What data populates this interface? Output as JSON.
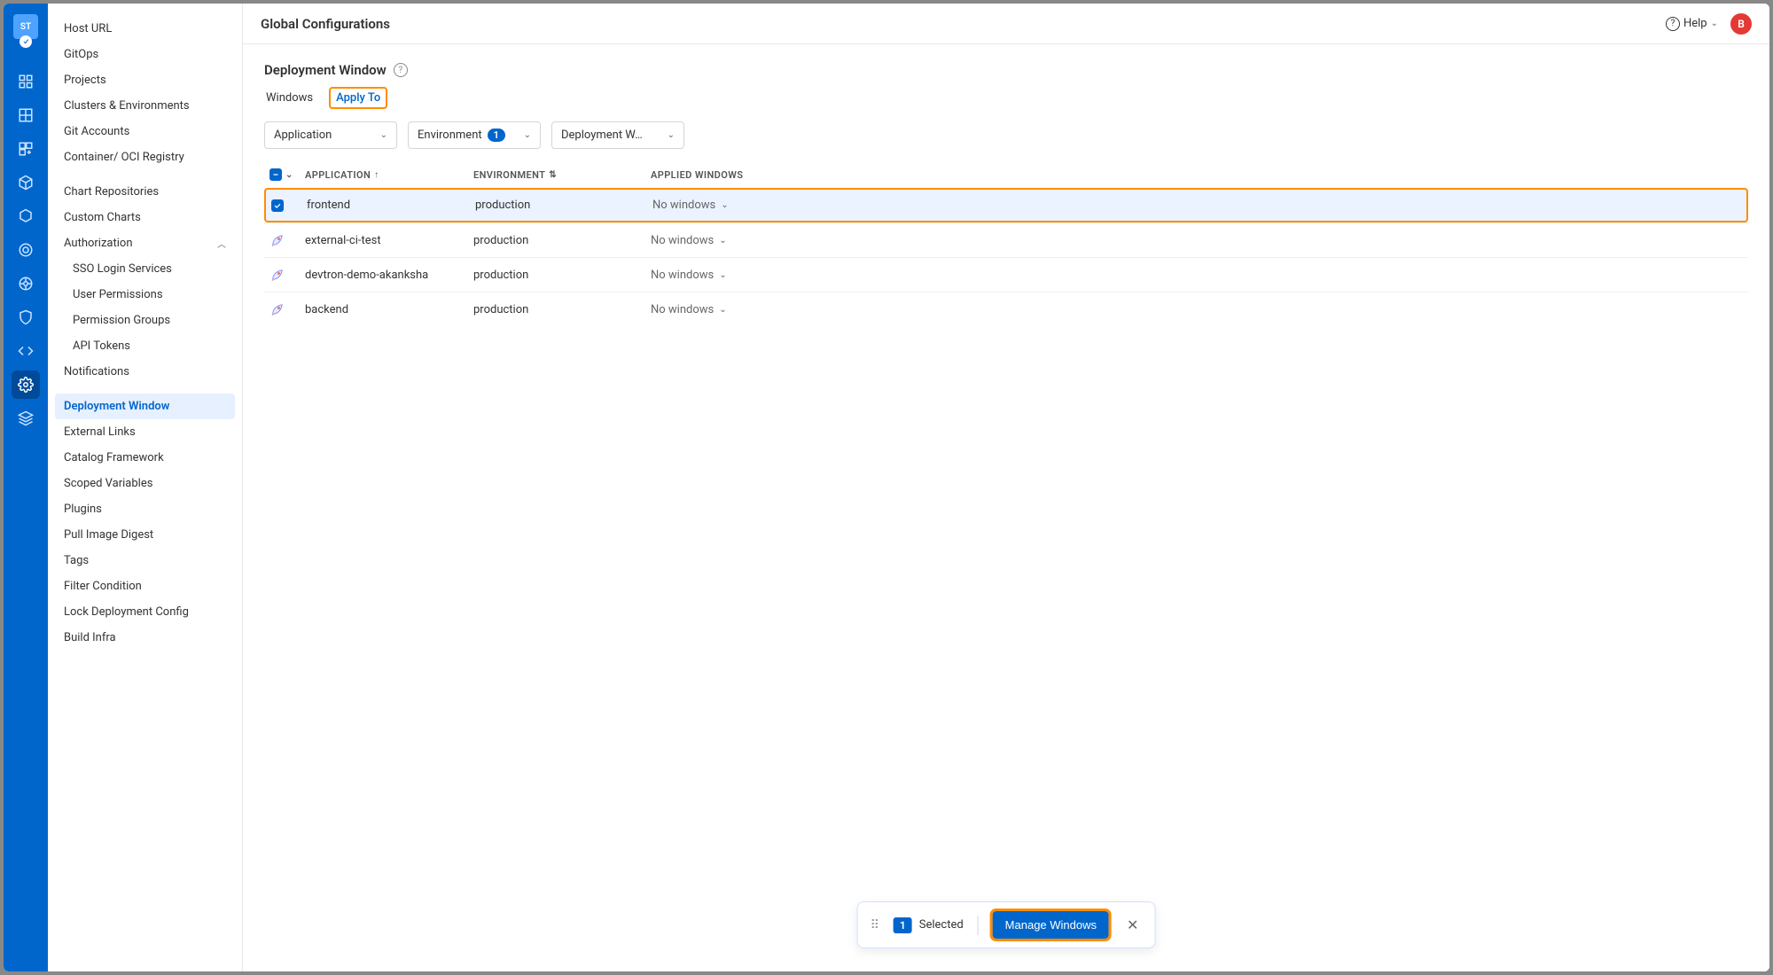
{
  "brand": {
    "logo_text": "ST",
    "avatar_initial": "B"
  },
  "topbar": {
    "title": "Global Configurations",
    "help_label": "Help"
  },
  "sidebar": {
    "items": [
      {
        "label": "Host URL"
      },
      {
        "label": "GitOps"
      },
      {
        "label": "Projects"
      },
      {
        "label": "Clusters & Environments"
      },
      {
        "label": "Git Accounts"
      },
      {
        "label": "Container/ OCI Registry"
      }
    ],
    "group2": [
      {
        "label": "Chart Repositories"
      },
      {
        "label": "Custom Charts"
      }
    ],
    "auth_label": "Authorization",
    "auth_items": [
      {
        "label": "SSO Login Services"
      },
      {
        "label": "User Permissions"
      },
      {
        "label": "Permission Groups"
      },
      {
        "label": "API Tokens"
      }
    ],
    "group3": [
      {
        "label": "Notifications"
      }
    ],
    "selected": {
      "label": "Deployment Window"
    },
    "group4": [
      {
        "label": "External Links"
      },
      {
        "label": "Catalog Framework"
      },
      {
        "label": "Scoped Variables"
      },
      {
        "label": "Plugins"
      },
      {
        "label": "Pull Image Digest"
      },
      {
        "label": "Tags"
      },
      {
        "label": "Filter Condition"
      },
      {
        "label": "Lock Deployment Config"
      },
      {
        "label": "Build Infra"
      }
    ]
  },
  "page": {
    "title": "Deployment Window",
    "tabs": {
      "windows": "Windows",
      "apply_to": "Apply To"
    },
    "filters": {
      "application": "Application",
      "environment": "Environment",
      "env_count": "1",
      "deployment_window": "Deployment W…"
    },
    "columns": {
      "app": "APPLICATION",
      "env": "ENVIRONMENT",
      "win": "APPLIED WINDOWS"
    },
    "rows": [
      {
        "app": "frontend",
        "env": "production",
        "win": "No windows",
        "checked": true
      },
      {
        "app": "external-ci-test",
        "env": "production",
        "win": "No windows",
        "checked": false
      },
      {
        "app": "devtron-demo-akanksha",
        "env": "production",
        "win": "No windows",
        "checked": false
      },
      {
        "app": "backend",
        "env": "production",
        "win": "No windows",
        "checked": false
      }
    ]
  },
  "selection_bar": {
    "count": "1",
    "label": "Selected",
    "manage": "Manage Windows"
  }
}
